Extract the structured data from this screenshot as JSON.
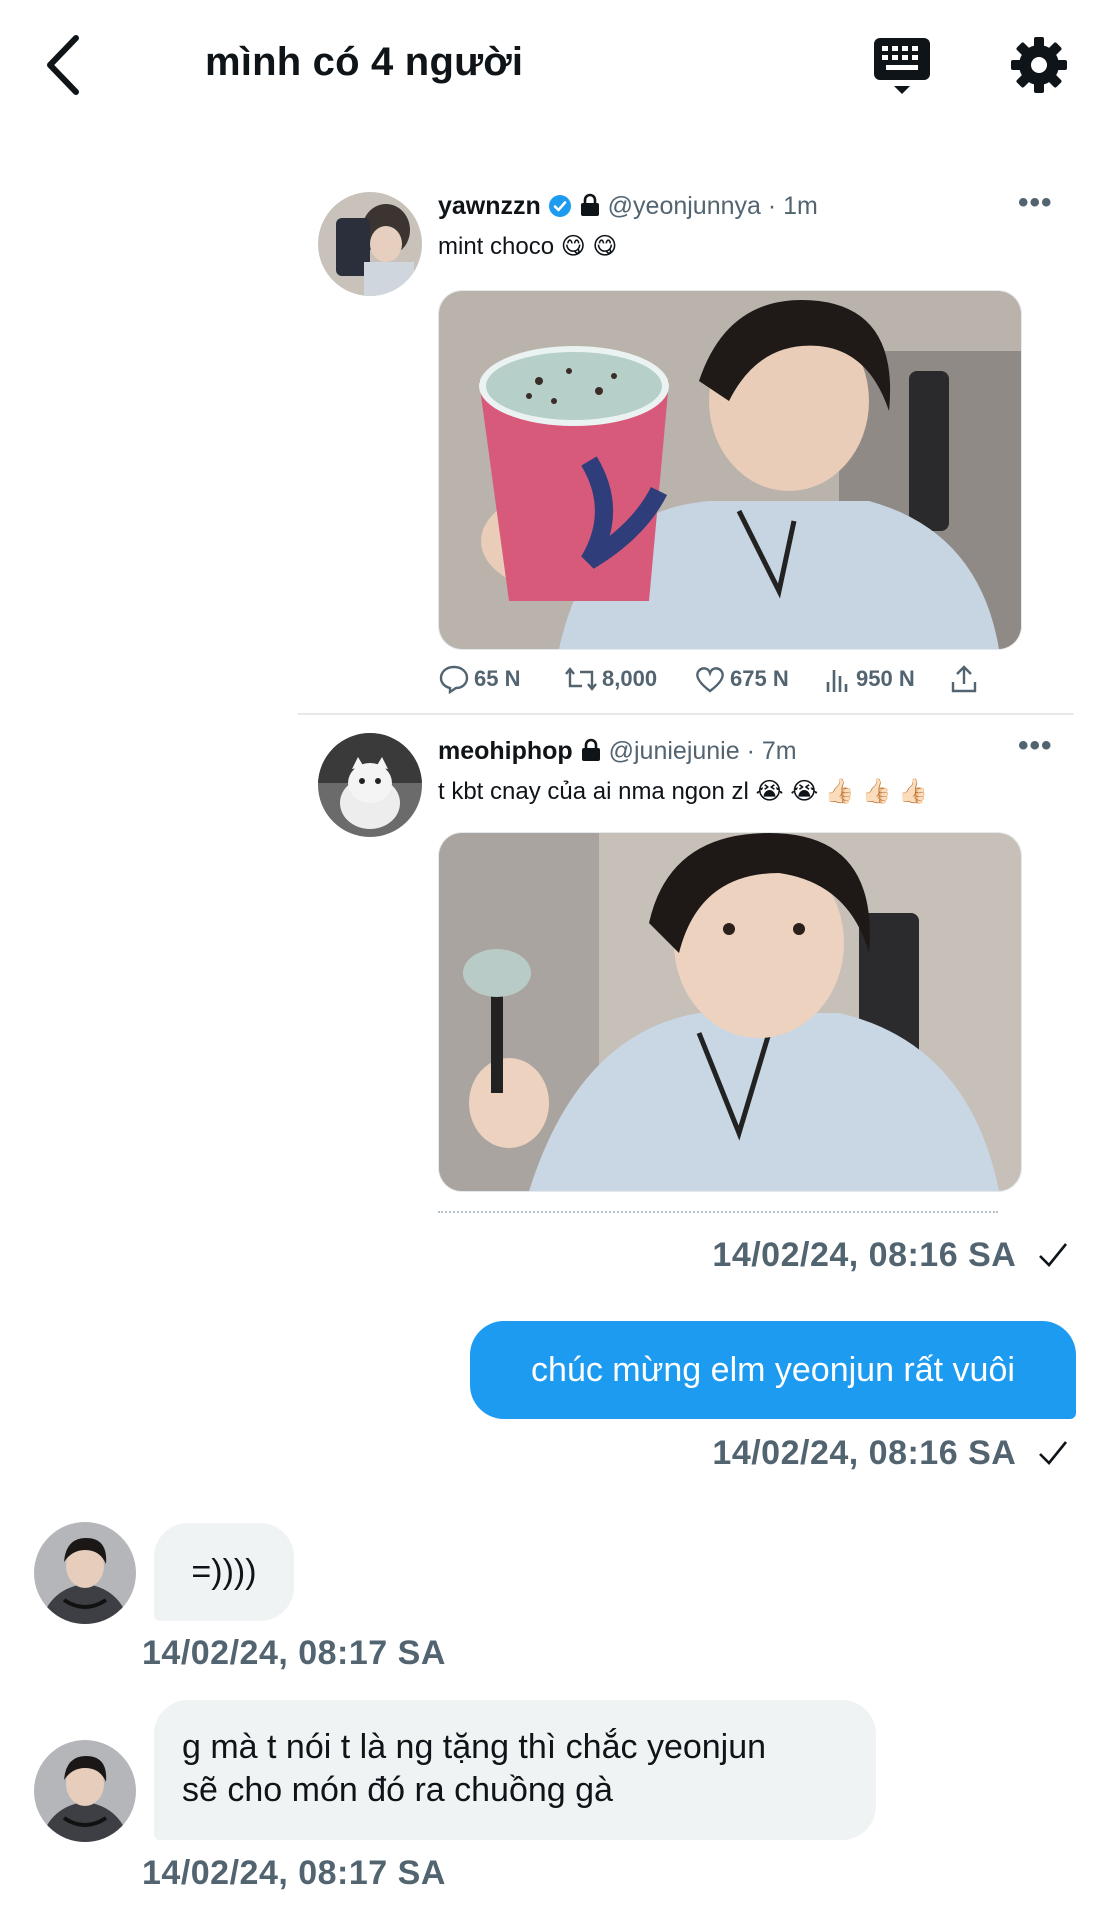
{
  "header": {
    "title": "mình có 4 người",
    "back_icon": "chevron-left-icon",
    "keyboard_icon": "keyboard-icon",
    "settings_icon": "gear-icon"
  },
  "tweets": [
    {
      "display_name": "yawnzzn",
      "handle": "@yeonjunnya",
      "time": "· 1m",
      "verified": true,
      "protected": true,
      "text": "mint choco 😋 😋",
      "media_desc": "man holding a cup of mint chocolate ice cream",
      "stats": {
        "replies": "65 N",
        "retweets": "8,000",
        "likes": "675 N",
        "views": "950 N"
      }
    },
    {
      "display_name": "meohiphop",
      "handle": "@juniejunie",
      "time": "· 7m",
      "verified": false,
      "protected": true,
      "text": "t kbt cnay của ai nma ngon zl 😭 😭 👍🏻 👍🏻 👍🏻",
      "media_desc": "man holding a spoon of mint chocolate ice cream"
    }
  ],
  "messages": [
    {
      "type": "card_timestamp",
      "text": "14/02/24, 08:16 SA"
    },
    {
      "type": "outgoing",
      "text": "chúc mừng elm yeonjun rất vuôi",
      "timestamp": "14/02/24, 08:16 SA"
    },
    {
      "type": "incoming",
      "text": "=))))",
      "timestamp": "14/02/24, 08:17 SA"
    },
    {
      "type": "incoming",
      "lines": [
        "g mà t nói t là ng tặng thì chắc yeonjun",
        "sẽ cho món đó ra chuồng gà"
      ],
      "timestamp": "14/02/24, 08:17 SA"
    }
  ],
  "colors": {
    "accent": "#1d9bf0",
    "incoming_bg": "#eff3f4",
    "muted": "#536471"
  }
}
